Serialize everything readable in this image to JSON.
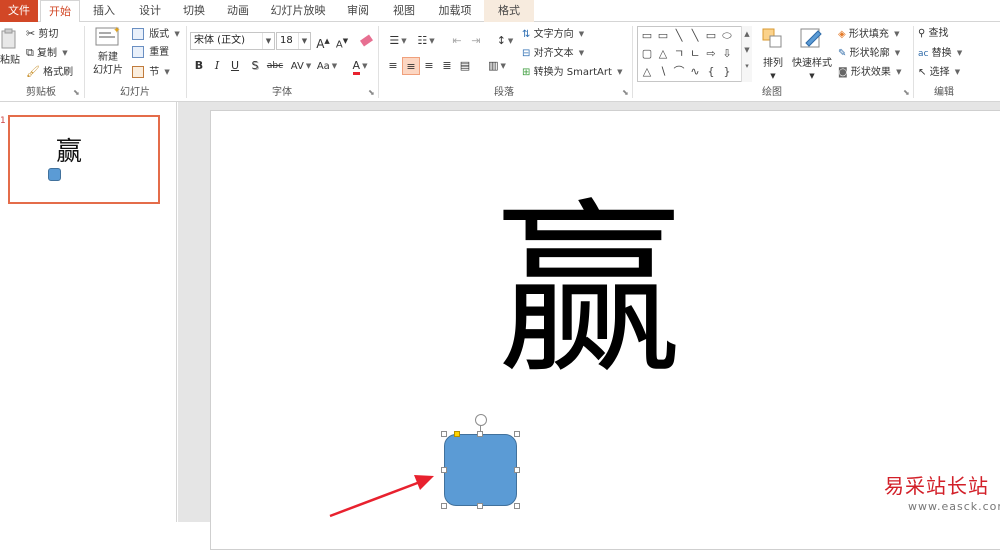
{
  "tabs": {
    "file": "文件",
    "home": "开始",
    "insert": "插入",
    "design": "设计",
    "transitions": "切换",
    "animations": "动画",
    "slideshow": "幻灯片放映",
    "review": "审阅",
    "view": "视图",
    "addins": "加载项",
    "format": "格式"
  },
  "clipboard": {
    "paste": "粘贴",
    "cut": "剪切",
    "copy": "复制",
    "format_painter": "格式刷",
    "group_label": "剪贴板"
  },
  "slides": {
    "new_slide_line1": "新建",
    "new_slide_line2": "幻灯片",
    "layout": "版式",
    "reset": "重置",
    "section": "节",
    "group_label": "幻灯片"
  },
  "font": {
    "font_name": "宋体 (正文)",
    "font_size": "18",
    "grow": "A",
    "shrink": "A",
    "bold": "B",
    "italic": "I",
    "underline": "U",
    "shadow": "S",
    "strikethrough": "abc",
    "spacing": "AV",
    "change_case": "Aa",
    "font_color": "A",
    "group_label": "字体"
  },
  "paragraph": {
    "text_direction": "文字方向",
    "align_text": "对齐文本",
    "convert_smartart": "转换为 SmartArt",
    "group_label": "段落"
  },
  "drawing": {
    "arrange": "排列",
    "quick_styles": "快速样式",
    "shape_fill": "形状填充",
    "shape_outline": "形状轮廓",
    "shape_effects": "形状效果",
    "group_label": "绘图"
  },
  "editing": {
    "find": "查找",
    "replace": "替换",
    "select": "选择",
    "group_label": "编辑"
  },
  "thumbnail": {
    "number": "1",
    "text": "赢"
  },
  "slide": {
    "big_text": "赢"
  },
  "watermark": {
    "text": "易采站长站",
    "url": "www.easck.com"
  },
  "colors": {
    "accent": "#d24726",
    "shape_fill": "#5b9bd5",
    "arrow": "#e8212e"
  }
}
